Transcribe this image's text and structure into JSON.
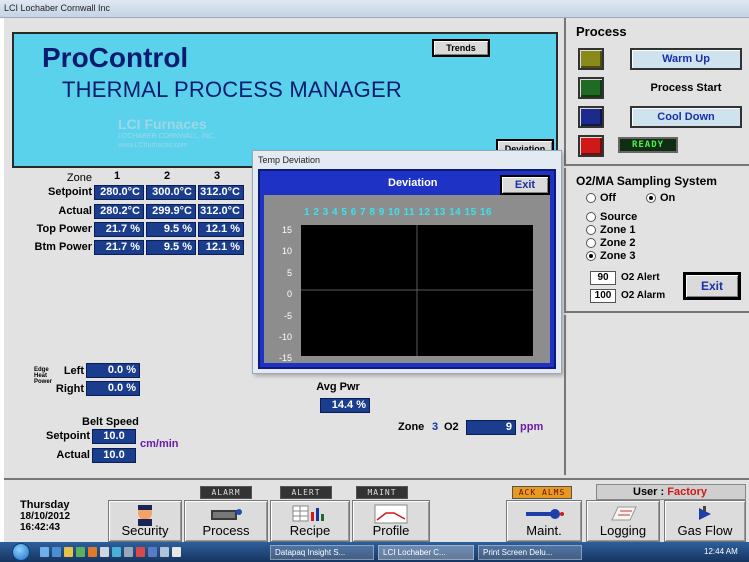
{
  "window": {
    "title": "LCI  Lochaber Cornwall Inc"
  },
  "banner": {
    "brand": "ProControl",
    "subtitle": "THERMAL PROCESS MANAGER",
    "watermark_company": "LCI Furnaces",
    "watermark_line2": "LOCHABER CORNWALL, INC.",
    "watermark_line3": "www.LCIfurnaces.com",
    "trends_label": "Trends",
    "deviation_label": "Deviation"
  },
  "process": {
    "title": "Process",
    "warm_up": "Warm Up",
    "process_start": "Process Start",
    "cool_down": "Cool Down",
    "ready": "READY",
    "colors": {
      "warm": "#8a8a1a",
      "start": "#1f6b24",
      "cool": "#1b2a8c",
      "stop": "#d01818"
    }
  },
  "zones": {
    "zone_label": "Zone",
    "headers": [
      "1",
      "2",
      "3"
    ],
    "rows": [
      {
        "label": "Setpoint",
        "values": [
          "280.0°C",
          "300.0°C",
          "312.0°C"
        ]
      },
      {
        "label": "Actual",
        "values": [
          "280.2°C",
          "299.9°C",
          "312.0°C"
        ]
      },
      {
        "label": "Top Power",
        "values": [
          "21.7 %",
          "9.5 %",
          "12.1 %"
        ]
      },
      {
        "label": "Btm Power",
        "values": [
          "21.7 %",
          "9.5 %",
          "12.1 %"
        ]
      }
    ]
  },
  "popup": {
    "title": "Temp Deviation",
    "heading": "Deviation",
    "exit": "Exit",
    "zone_numbers": "1  2  3  4  5  6  7  8  9 10 11 12 13 14 15 16",
    "y_ticks": [
      "15",
      "10",
      "5",
      "0",
      "-5",
      "-10",
      "-15"
    ]
  },
  "sampling": {
    "title": "O2/MA Sampling System",
    "off": "Off",
    "on": "On",
    "source": "Source",
    "zone1": "Zone  1",
    "zone2": "Zone  2",
    "zone3": "Zone  3",
    "alert_value": "90",
    "alert_label": "O2 Alert",
    "alarm_value": "100",
    "alarm_label": "O2 Alarm",
    "exit": "Exit"
  },
  "edge": {
    "caption_1": "Edge",
    "caption_2": "Heat",
    "caption_3": "Power",
    "left_label": "Left",
    "left_value": "0.0 %",
    "right_label": "Right",
    "right_value": "0.0 %"
  },
  "avg_pwr": {
    "label": "Avg Pwr",
    "value": "14.4 %"
  },
  "zone_o2": {
    "label_prefix": "Zone",
    "zone": "3",
    "label_suffix": "O2",
    "value": "9",
    "unit": "ppm"
  },
  "belt": {
    "title": "Belt Speed",
    "setpoint_label": "Setpoint",
    "setpoint_value": "10.0",
    "actual_label": "Actual",
    "actual_value": "10.0",
    "unit": "cm/min"
  },
  "status": {
    "alarm": "ALARM",
    "alert": "ALERT",
    "maint": "MAINT",
    "ack": "ACK ALMS",
    "user_label": "User :",
    "user_name": "Factory"
  },
  "clock": {
    "day": "Thursday",
    "date": "18/10/2012",
    "time": "16:42:43"
  },
  "nav": {
    "security": "Security",
    "process": "Process",
    "recipe": "Recipe",
    "profile": "Profile",
    "maint": "Maint.",
    "logging": "Logging",
    "gasflow": "Gas Flow"
  },
  "taskbar": {
    "task1": "Datapaq Insight S...",
    "task2": "LCI Lochaber C...",
    "task3": "Print Screen Delu...",
    "time": "12:44 AM"
  }
}
